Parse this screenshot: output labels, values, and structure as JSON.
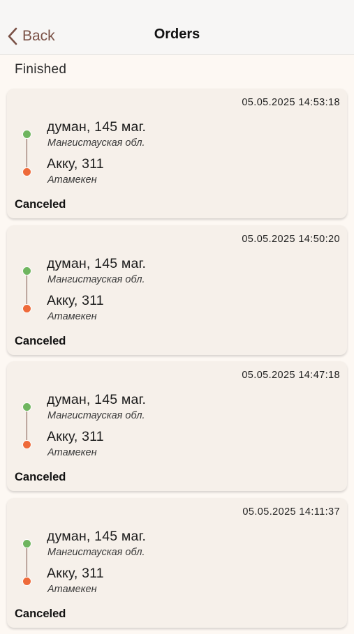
{
  "header": {
    "back_label": "Back",
    "title": "Orders"
  },
  "section": {
    "title": "Finished"
  },
  "colors": {
    "accent": "#7a5146",
    "from_dot": "#6fb55f",
    "to_dot": "#ee6a3a",
    "card_bg": "#f6f0ea",
    "page_bg": "#fdf8f3"
  },
  "orders": [
    {
      "datetime": "05.05.2025 14:53:18",
      "from_address": "думан, 145 маг.",
      "from_region": "Мангистауская обл.",
      "to_address": "Акку, 311",
      "to_region": "Атамекен",
      "status": "Canceled"
    },
    {
      "datetime": "05.05.2025 14:50:20",
      "from_address": "думан, 145 маг.",
      "from_region": "Мангистауская обл.",
      "to_address": "Акку, 311",
      "to_region": "Атамекен",
      "status": "Canceled"
    },
    {
      "datetime": "05.05.2025 14:47:18",
      "from_address": "думан, 145 маг.",
      "from_region": "Мангистауская обл.",
      "to_address": "Акку, 311",
      "to_region": "Атамекен",
      "status": "Canceled"
    },
    {
      "datetime": "05.05.2025 14:11:37",
      "from_address": "думан, 145 маг.",
      "from_region": "Мангистауская обл.",
      "to_address": "Акку, 311",
      "to_region": "Атамекен",
      "status": "Canceled"
    }
  ]
}
